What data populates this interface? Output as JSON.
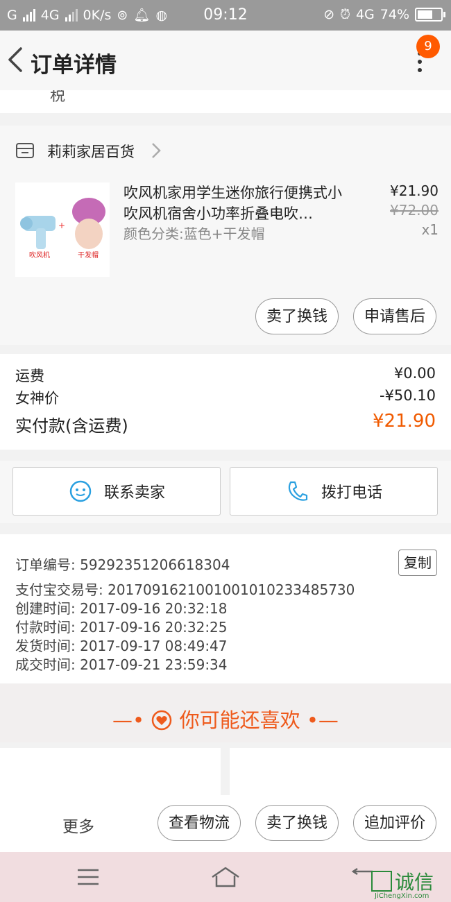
{
  "status_bar": {
    "carrier": "G",
    "network": "4G",
    "speed": "0K/s",
    "time": "09:12",
    "network2": "4G",
    "battery": "74%",
    "battery_level": 0.74
  },
  "header": {
    "title": "订单详情",
    "badge_count": "9"
  },
  "cut_text": "税",
  "store": {
    "name": "莉莉家居百货"
  },
  "product": {
    "title": "吹风机家用学生迷你旅行便携式小吹风机宿舍小功率折叠电吹…",
    "sku": "颜色分类:蓝色+干发帽",
    "price": "¥21.90",
    "original_price": "¥72.00",
    "quantity": "x1",
    "image_labels": [
      "吹风机",
      "干发帽"
    ],
    "btn_resell": "卖了换钱",
    "btn_aftersale": "申请售后"
  },
  "fees": {
    "shipping_label": "运费",
    "shipping_value": "¥0.00",
    "discount_label": "女神价",
    "discount_value": "-¥50.10",
    "total_label": "实付款(含运费)",
    "total_value": "¥21.90"
  },
  "contact": {
    "seller_label": "联系卖家",
    "phone_label": "拨打电话"
  },
  "order_info": {
    "order_no": "订单编号: 59292351206618304",
    "copy_label": "复制",
    "alipay_no": "支付宝交易号: 2017091621001001010233485730",
    "created": "创建时间: 2017-09-16  20:32:18",
    "paid": "付款时间: 2017-09-16  20:32:25",
    "shipped": "发货时间: 2017-09-17  08:49:47",
    "completed": "成交时间: 2017-09-21  23:59:34"
  },
  "recommend": {
    "title": "你可能还喜欢"
  },
  "bottom_bar": {
    "more": "更多",
    "logistics": "查看物流",
    "resell": "卖了换钱",
    "add_review": "追加评价"
  },
  "watermark": {
    "text": "诚信",
    "sub": "JiChengXin.com"
  },
  "colors": {
    "accent": "#f05a00",
    "badge": "#ff5a00",
    "contact_icon": "#2aa0e0"
  }
}
